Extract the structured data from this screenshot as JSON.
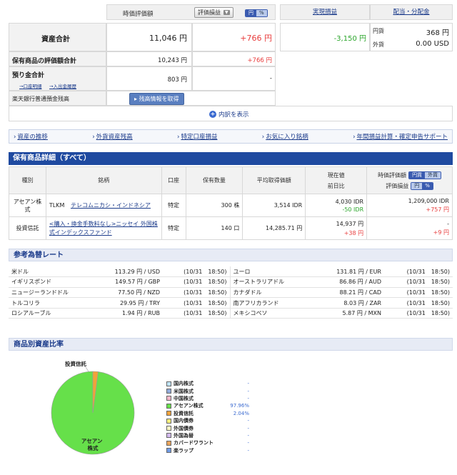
{
  "summary": {
    "col_hyouka": "時価評価額",
    "select_label": "評価損益",
    "toggle": [
      "円",
      "%"
    ],
    "col_jitsugen": "実現損益",
    "col_haito": "配当・分配金",
    "total_label": "資産合計",
    "total_value": "11,046 円",
    "total_pl": "+766 円",
    "realized": "-3,150 円",
    "div_jpy_label": "円貨",
    "div_jpy_value": "368 円",
    "div_fx_label": "外貨",
    "div_fx_value": "0.00 USD",
    "holdings_label": "保有商品の評価額合計",
    "holdings_value": "10,243 円",
    "holdings_pl": "+766 円",
    "deposit_label": "預り金合計",
    "deposit_value": "803 円",
    "deposit_pl": "-",
    "deposit_link1": "→口座明細",
    "deposit_link2": "→入出金履歴",
    "bank_label": "楽天銀行普通預金残高",
    "bank_button": "残高情報を取得",
    "detail_link": "内訳を表示"
  },
  "links": [
    "資産の推移",
    "外貨資産残高",
    "特定口座損益",
    "お気に入り銘柄",
    "年間損益計算・確定申告サポート"
  ],
  "holdings_title": "保有商品詳細（すべて）",
  "holdings_table": {
    "headers": {
      "type": "種別",
      "name": "銘柄",
      "account": "口座",
      "qty": "保有数量",
      "avg": "平均取得価額",
      "price1": "現在値",
      "price2": "前日比",
      "eval1": "時価評価額",
      "eval2": "評価損益",
      "toggle1": [
        "円貨",
        "外貨"
      ],
      "toggle2": [
        "円",
        "%"
      ]
    },
    "rows": [
      {
        "type": "アセアン株式",
        "ticker": "TLKM",
        "name": "テレコムニカシ・インドネシア",
        "account": "特定",
        "qty": "300 株",
        "avg": "3,514 IDR",
        "price": "4,030 IDR",
        "change": "-50 IDR",
        "eval": "1,209,000 IDR",
        "pl": "+757 円"
      },
      {
        "type": "投資信託",
        "ticker": "",
        "name": "<購入・換金手数料なし>ニッセイ 外国株式インデックスファンド",
        "account": "特定",
        "qty": "140 口",
        "avg": "14,285.71 円",
        "price": "14,937 円",
        "change": "+38 円",
        "eval": "-",
        "pl": "+9 円"
      }
    ]
  },
  "fx_title": "参考為替レート",
  "fx_rows": [
    {
      "l_name": "米ドル",
      "l_rate": "113.29 円 / USD",
      "l_time": "(10/31　18:50)",
      "r_name": "ユーロ",
      "r_rate": "131.81 円 / EUR",
      "r_time": "(10/31　18:50)"
    },
    {
      "l_name": "イギリスポンド",
      "l_rate": "149.57 円 / GBP",
      "l_time": "(10/31　18:50)",
      "r_name": "オーストラリアドル",
      "r_rate": "86.86 円 / AUD",
      "r_time": "(10/31　18:50)"
    },
    {
      "l_name": "ニュージーランドドル",
      "l_rate": "77.50 円 / NZD",
      "l_time": "(10/31　18:50)",
      "r_name": "カナダドル",
      "r_rate": "88.21 円 / CAD",
      "r_time": "(10/31　18:50)"
    },
    {
      "l_name": "トルコリラ",
      "l_rate": "29.95 円 / TRY",
      "l_time": "(10/31　18:50)",
      "r_name": "南アフリカランド",
      "r_rate": "8.03 円 / ZAR",
      "r_time": "(10/31　18:50)"
    },
    {
      "l_name": "ロシアルーブル",
      "l_rate": "1.94 円 / RUB",
      "l_time": "(10/31　18:50)",
      "r_name": "メキシコペソ",
      "r_rate": "5.87 円 / MXN",
      "r_time": "(10/31　18:50)"
    }
  ],
  "ratio_title": "商品別資産比率",
  "chart_data": {
    "type": "pie",
    "slices": [
      {
        "label": "アセアン株式",
        "value": 97.96,
        "color": "#66e04a"
      },
      {
        "label": "投資信託",
        "value": 2.04,
        "color": "#f2a23a"
      }
    ],
    "slice_labels": [
      "アセアン株式",
      "投資信託"
    ],
    "legend": [
      {
        "name": "国内株式",
        "pct": "-",
        "color": "#bfe3f7"
      },
      {
        "name": "米国株式",
        "pct": "-",
        "color": "#8fa8d8"
      },
      {
        "name": "中国株式",
        "pct": "-",
        "color": "#f4b6c8"
      },
      {
        "name": "アセアン株式",
        "pct": "97.96%",
        "color": "#66e04a"
      },
      {
        "name": "投資信託",
        "pct": "2.04%",
        "color": "#f2a23a"
      },
      {
        "name": "国内債券",
        "pct": "-",
        "color": "#f6ee7a"
      },
      {
        "name": "外国債券",
        "pct": "-",
        "color": "#fbf7c4"
      },
      {
        "name": "外国為替",
        "pct": "-",
        "color": "#d2b8ee"
      },
      {
        "name": "カバードワラント",
        "pct": "-",
        "color": "#e9a35a"
      },
      {
        "name": "楽ラップ",
        "pct": "-",
        "color": "#6f9be6"
      }
    ]
  }
}
